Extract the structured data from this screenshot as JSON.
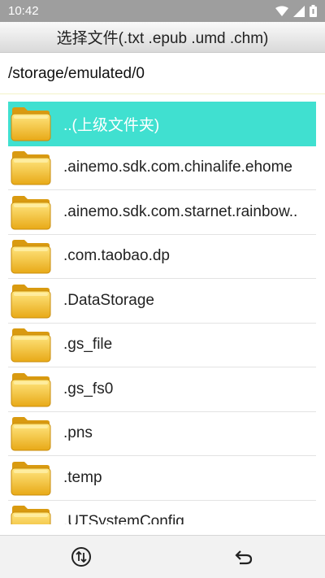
{
  "status": {
    "time": "10:42"
  },
  "title": "选择文件(.txt .epub .umd .chm)",
  "path": "/storage/emulated/0",
  "colors": {
    "selected_bg": "#40e0d0",
    "folder": "#f2c12e"
  },
  "files": [
    {
      "name": "..(上级文件夹)",
      "selected": true
    },
    {
      "name": ".ainemo.sdk.com.chinalife.ehome",
      "selected": false
    },
    {
      "name": ".ainemo.sdk.com.starnet.rainbow..",
      "selected": false
    },
    {
      "name": ".com.taobao.dp",
      "selected": false
    },
    {
      "name": ".DataStorage",
      "selected": false
    },
    {
      "name": ".gs_file",
      "selected": false
    },
    {
      "name": ".gs_fs0",
      "selected": false
    },
    {
      "name": ".pns",
      "selected": false
    },
    {
      "name": ".temp",
      "selected": false
    },
    {
      "name": ".UTSystemConfig",
      "selected": false
    }
  ],
  "bottom": {
    "sort_icon": "sort-icon",
    "back_icon": "back-icon"
  }
}
